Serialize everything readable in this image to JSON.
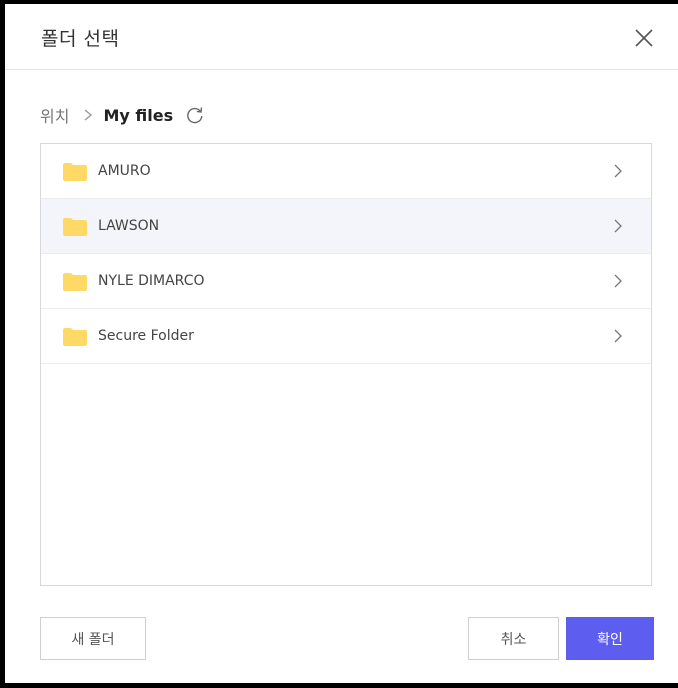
{
  "dialog": {
    "title": "폴더 선택",
    "close_icon": "close-icon"
  },
  "breadcrumb": {
    "root": "위치",
    "separator_icon": "chevron-right-icon",
    "current": "My files",
    "refresh_icon": "refresh-icon"
  },
  "folders": [
    {
      "name": "AMURO",
      "icon": "folder-icon",
      "hover": false
    },
    {
      "name": "LAWSON",
      "icon": "folder-icon",
      "hover": true
    },
    {
      "name": "NYLE DIMARCO",
      "icon": "folder-icon",
      "hover": false
    },
    {
      "name": "Secure Folder",
      "icon": "folder-icon",
      "hover": false
    }
  ],
  "buttons": {
    "new_folder": "새 폴더",
    "cancel": "취소",
    "confirm": "확인"
  },
  "colors": {
    "accent": "#5d5ef0",
    "folder": "#ffd966",
    "hover_row": "#f4f5fb"
  }
}
